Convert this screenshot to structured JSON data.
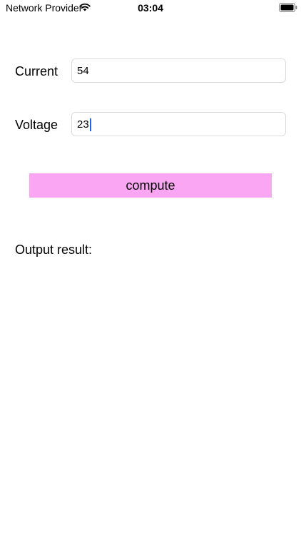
{
  "status_bar": {
    "carrier": "Network Provider",
    "time": "03:04",
    "wifi_icon": "wifi-icon",
    "battery_icon": "battery-icon"
  },
  "form": {
    "current_label": "Current",
    "current_value": "54",
    "voltage_label": "Voltage",
    "voltage_value": "23",
    "focused_field": "voltage"
  },
  "compute_button": {
    "label": "compute",
    "color": "#fba6f3"
  },
  "output": {
    "label": "Output result:"
  },
  "colors": {
    "caret": "#1f64e0",
    "field_border": "#dcdcdc"
  }
}
